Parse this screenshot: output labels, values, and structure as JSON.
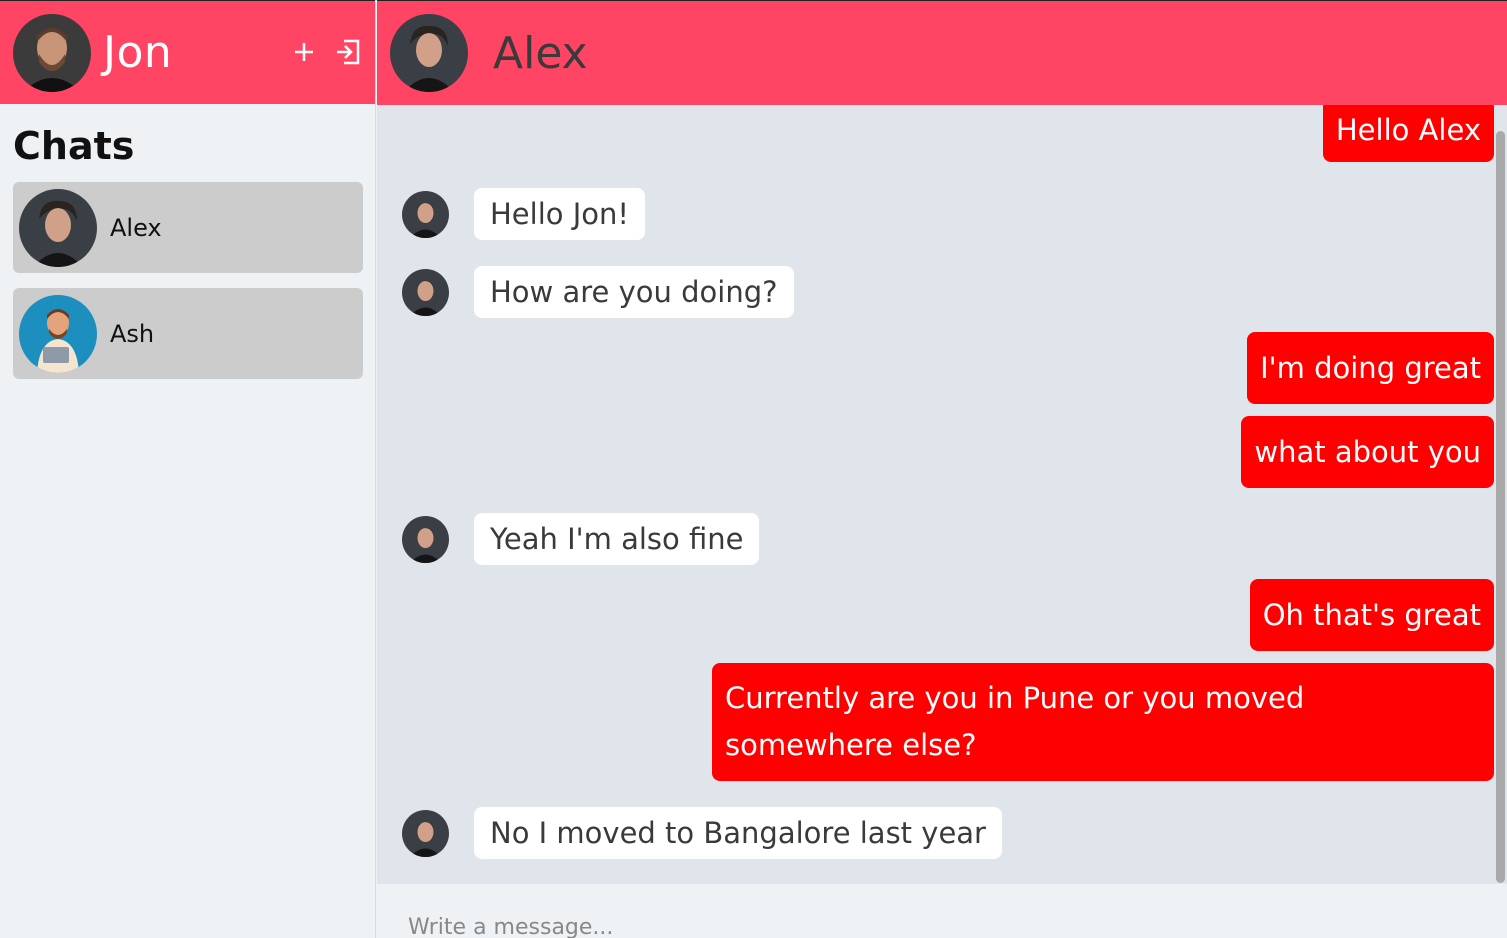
{
  "user": {
    "name": "Jon"
  },
  "sidebar": {
    "title": "Chats",
    "actions": {
      "add_icon": "plus-icon",
      "logout_icon": "logout-icon"
    },
    "chats": [
      {
        "name": "Alex"
      },
      {
        "name": "Ash"
      }
    ]
  },
  "conversation": {
    "contact_name": "Alex",
    "messages": [
      {
        "direction": "outgoing",
        "text": "Hello Alex"
      },
      {
        "direction": "incoming",
        "text": "Hello Jon!"
      },
      {
        "direction": "incoming",
        "text": "How are you doing?"
      },
      {
        "direction": "outgoing",
        "text": "I'm doing great"
      },
      {
        "direction": "outgoing",
        "text": "what about you"
      },
      {
        "direction": "incoming",
        "text": "Yeah I'm also fine"
      },
      {
        "direction": "outgoing",
        "text": "Oh that's great"
      },
      {
        "direction": "outgoing",
        "text": "Currently are you in Pune or you moved somewhere else?"
      },
      {
        "direction": "incoming",
        "text": "No I moved to Bangalore last year"
      }
    ]
  },
  "composer": {
    "placeholder": "Write a message..."
  },
  "colors": {
    "accent": "#ff4563",
    "outgoing_bubble": "#ff0000",
    "incoming_bubble": "#ffffff",
    "chat_item_bg": "#cccccc"
  }
}
